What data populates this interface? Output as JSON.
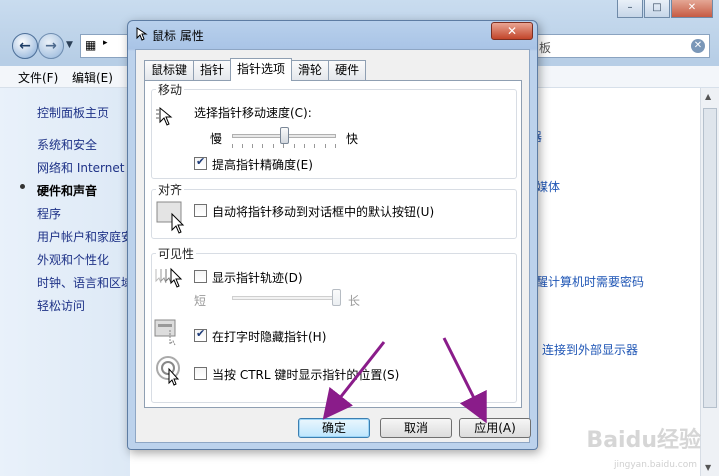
{
  "control_panel": {
    "search_fragment": "板",
    "menu": {
      "file": "文件(F)",
      "edit": "编辑(E)"
    },
    "sidebar": {
      "home": "控制面板主页",
      "items": [
        {
          "label": "系统和安全"
        },
        {
          "label": "网络和 Internet"
        },
        {
          "label": "硬件和声音",
          "active": true
        },
        {
          "label": "程序"
        },
        {
          "label": "用户帐户和家庭安"
        },
        {
          "label": "外观和个性化"
        },
        {
          "label": "时钟、语言和区域"
        },
        {
          "label": "轻松访问"
        }
      ]
    },
    "content_links": {
      "media": "媒体",
      "password": "醒计算机时需要密码",
      "display": "连接到外部显示器",
      "fragment": "器"
    }
  },
  "dialog": {
    "title": "鼠标 属性",
    "close_label": "✕",
    "tabs": [
      "鼠标键",
      "指针",
      "指针选项",
      "滑轮",
      "硬件"
    ],
    "active_tab": 2,
    "motion": {
      "group_title": "移动",
      "speed_label": "选择指针移动速度(C):",
      "slow": "慢",
      "fast": "快",
      "speed_value": 0.5,
      "precision_label": "提高指针精确度(E)",
      "precision_checked": true
    },
    "snap": {
      "group_title": "对齐",
      "snap_label": "自动将指针移动到对话框中的默认按钮(U)",
      "snap_checked": false
    },
    "visibility": {
      "group_title": "可见性",
      "trails_label": "显示指针轨迹(D)",
      "trails_checked": false,
      "short": "短",
      "long": "长",
      "trail_value": 1.0,
      "hide_label": "在打字时隐藏指针(H)",
      "hide_checked": true,
      "ctrl_label": "当按 CTRL 键时显示指针的位置(S)",
      "ctrl_checked": false
    },
    "buttons": {
      "ok": "确定",
      "cancel": "取消",
      "apply": "应用(A)"
    }
  },
  "watermark": {
    "main": "Baidu经验",
    "sub": "jingyan.baidu.com"
  },
  "colors": {
    "accent": "#1e55b5",
    "arrow": "#8a1c8a"
  }
}
